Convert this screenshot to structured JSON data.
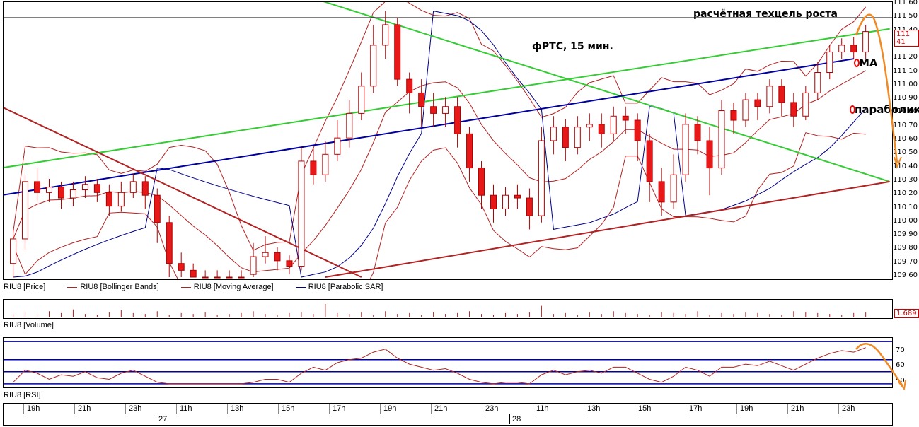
{
  "chart_data": [
    {
      "type": "line",
      "pane": "price",
      "title": "фРТС, 15 мин.",
      "ylim": [
        109.6,
        111.6
      ],
      "ticks": [
        "111 60",
        "111 50",
        "111 40",
        "111 30",
        "111 20",
        "111 10",
        "111 00",
        "110 90",
        "110 80",
        "110 70",
        "110 60",
        "110 50",
        "110 40",
        "110 30",
        "110 20",
        "110 10",
        "110 00",
        "109 90",
        "109 80",
        "109 70",
        "109 60"
      ],
      "last_price_label": "111 41",
      "legend": [
        {
          "name": "RIU8 [Price]",
          "color": "#000000"
        },
        {
          "name": "RIU8 [Bollinger Bands]",
          "color": "#b22222"
        },
        {
          "name": "RIU8 [Moving Average]",
          "color": "#b22222"
        },
        {
          "name": "RIU8 [Parabolic SAR]",
          "color": "#00008b"
        }
      ],
      "annotations": {
        "target": "расчётная техцель роста",
        "ma": "MA",
        "parabolic": "параболик"
      },
      "candles": [
        [
          109.7,
          109.88,
          109.6,
          109.95
        ],
        [
          109.88,
          110.3,
          109.8,
          110.35
        ],
        [
          110.3,
          110.22,
          110.15,
          110.4
        ],
        [
          110.22,
          110.26,
          110.15,
          110.32
        ],
        [
          110.26,
          110.18,
          110.1,
          110.3
        ],
        [
          110.18,
          110.24,
          110.12,
          110.3
        ],
        [
          110.24,
          110.28,
          110.18,
          110.34
        ],
        [
          110.28,
          110.22,
          110.15,
          110.32
        ],
        [
          110.22,
          110.12,
          110.05,
          110.28
        ],
        [
          110.12,
          110.22,
          110.08,
          110.3
        ],
        [
          110.22,
          110.3,
          110.18,
          110.36
        ],
        [
          110.3,
          110.2,
          110.1,
          110.34
        ],
        [
          110.2,
          110.0,
          109.85,
          110.25
        ],
        [
          110.0,
          109.7,
          109.6,
          110.05
        ],
        [
          109.7,
          109.65,
          109.6,
          109.78
        ],
        [
          109.65,
          109.6,
          109.6,
          109.7
        ],
        [
          109.6,
          109.6,
          109.6,
          109.65
        ],
        [
          109.6,
          109.6,
          109.6,
          109.65
        ],
        [
          109.6,
          109.6,
          109.6,
          109.65
        ],
        [
          109.6,
          109.6,
          109.6,
          109.65
        ],
        [
          109.62,
          109.75,
          109.6,
          109.85
        ],
        [
          109.75,
          109.78,
          109.7,
          109.9
        ],
        [
          109.78,
          109.72,
          109.65,
          109.82
        ],
        [
          109.72,
          109.68,
          109.62,
          109.76
        ],
        [
          109.68,
          110.45,
          109.65,
          110.55
        ],
        [
          110.45,
          110.35,
          110.28,
          110.55
        ],
        [
          110.35,
          110.5,
          110.3,
          110.6
        ],
        [
          110.5,
          110.62,
          110.45,
          110.75
        ],
        [
          110.62,
          110.8,
          110.55,
          110.9
        ],
        [
          110.8,
          111.0,
          110.75,
          111.1
        ],
        [
          111.0,
          111.3,
          110.95,
          111.45
        ],
        [
          111.3,
          111.45,
          111.2,
          111.55
        ],
        [
          111.45,
          111.05,
          111.0,
          111.5
        ],
        [
          111.05,
          110.95,
          110.8,
          111.1
        ],
        [
          110.95,
          110.85,
          110.7,
          111.05
        ],
        [
          110.85,
          110.8,
          110.7,
          110.95
        ],
        [
          110.8,
          110.85,
          110.7,
          110.92
        ],
        [
          110.85,
          110.65,
          110.55,
          110.92
        ],
        [
          110.65,
          110.4,
          110.3,
          110.7
        ],
        [
          110.4,
          110.2,
          110.1,
          110.45
        ],
        [
          110.2,
          110.1,
          110.0,
          110.28
        ],
        [
          110.1,
          110.2,
          110.05,
          110.26
        ],
        [
          110.2,
          110.18,
          110.1,
          110.28
        ],
        [
          110.18,
          110.05,
          109.95,
          110.25
        ],
        [
          110.05,
          110.6,
          110.0,
          110.7
        ],
        [
          110.6,
          110.7,
          110.5,
          110.78
        ],
        [
          110.7,
          110.55,
          110.45,
          110.76
        ],
        [
          110.55,
          110.7,
          110.5,
          110.78
        ],
        [
          110.7,
          110.72,
          110.6,
          110.8
        ],
        [
          110.72,
          110.65,
          110.55,
          110.8
        ],
        [
          110.65,
          110.78,
          110.6,
          110.85
        ],
        [
          110.78,
          110.75,
          110.65,
          110.85
        ],
        [
          110.75,
          110.6,
          110.45,
          110.8
        ],
        [
          110.6,
          110.3,
          110.15,
          110.65
        ],
        [
          110.3,
          110.15,
          110.05,
          110.4
        ],
        [
          110.15,
          110.35,
          110.1,
          110.5
        ],
        [
          110.35,
          110.72,
          110.3,
          110.8
        ],
        [
          110.72,
          110.6,
          110.5,
          110.78
        ],
        [
          110.6,
          110.4,
          110.2,
          110.7
        ],
        [
          110.4,
          110.82,
          110.35,
          110.9
        ],
        [
          110.82,
          110.75,
          110.65,
          110.88
        ],
        [
          110.75,
          110.9,
          110.7,
          110.95
        ],
        [
          110.9,
          110.85,
          110.75,
          110.95
        ],
        [
          110.85,
          111.0,
          110.8,
          111.05
        ],
        [
          111.0,
          110.88,
          110.78,
          111.05
        ],
        [
          110.88,
          110.78,
          110.7,
          110.95
        ],
        [
          110.78,
          110.95,
          110.75,
          111.0
        ],
        [
          110.95,
          111.1,
          110.9,
          111.18
        ],
        [
          111.1,
          111.25,
          111.05,
          111.3
        ],
        [
          111.25,
          111.3,
          111.2,
          111.35
        ],
        [
          111.3,
          111.25,
          111.2,
          111.36
        ],
        [
          111.25,
          111.4,
          111.2,
          111.45
        ]
      ]
    },
    {
      "type": "bar",
      "pane": "volume",
      "legend": "RIU8 [Volume]",
      "last_value_label": "1.689",
      "values": [
        3,
        5,
        2,
        6,
        4,
        8,
        3,
        2,
        5,
        7,
        4,
        3,
        6,
        2,
        4,
        3,
        5,
        2,
        3,
        4,
        6,
        3,
        2,
        4,
        5,
        3,
        14,
        4,
        3,
        5,
        2,
        6,
        3,
        4,
        2,
        5,
        3,
        4,
        6,
        3,
        2,
        4,
        3,
        5,
        12,
        3,
        4,
        2,
        5,
        3,
        6,
        4,
        3,
        2,
        5,
        4,
        3,
        6,
        2,
        4,
        3,
        5,
        4,
        3,
        2,
        6,
        5,
        4,
        3,
        2,
        4,
        5
      ]
    },
    {
      "type": "line",
      "pane": "rsi",
      "legend": "RIU8 [RSI]",
      "ylim": [
        48,
        78
      ],
      "ticks": [
        "70",
        "60",
        "50"
      ],
      "levels": [
        77,
        65,
        57,
        49
      ],
      "values": [
        50,
        58,
        56,
        52,
        55,
        54,
        57,
        53,
        52,
        56,
        58,
        54,
        50,
        49,
        49,
        49,
        49,
        49,
        49,
        49,
        50,
        52,
        52,
        50,
        56,
        60,
        58,
        63,
        65,
        66,
        70,
        72,
        66,
        62,
        60,
        58,
        59,
        56,
        52,
        50,
        49,
        50,
        50,
        49,
        55,
        58,
        55,
        57,
        58,
        56,
        60,
        60,
        56,
        52,
        50,
        54,
        60,
        58,
        54,
        60,
        60,
        62,
        61,
        64,
        61,
        58,
        62,
        66,
        69,
        71,
        70,
        73
      ]
    },
    {
      "type": "table",
      "pane": "time-axis",
      "hours": [
        "19h",
        "21h",
        "23h",
        "11h",
        "13h",
        "15h",
        "17h",
        "19h",
        "21h",
        "23h",
        "11h",
        "13h",
        "15h",
        "17h",
        "19h",
        "21h",
        "23h"
      ],
      "dates": [
        "27",
        "28"
      ]
    }
  ],
  "colors": {
    "bull_candle": "#ffffff",
    "bear_candle": "#e81818",
    "candle_edge": "#b00000",
    "bollinger": "#b22222",
    "ma": "#b22222",
    "sar": "#00008b",
    "green_trend": "#33cc33",
    "blue_trend": "#0000a0",
    "red_trend": "#b22222",
    "forecast": "#f08a24",
    "rsi_line": "#b22222",
    "rsi_level": "#0000a0"
  }
}
